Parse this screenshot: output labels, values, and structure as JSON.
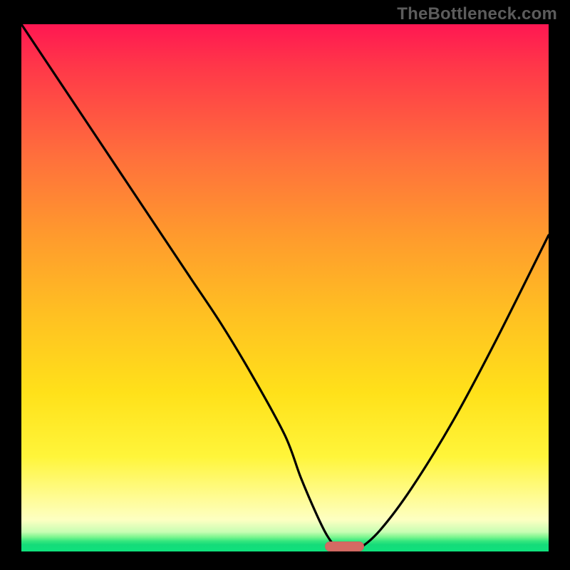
{
  "watermark": "TheBottleneck.com",
  "chart_data": {
    "type": "line",
    "title": "",
    "xlabel": "",
    "ylabel": "",
    "xlim": [
      0,
      100
    ],
    "ylim": [
      0,
      100
    ],
    "grid": false,
    "legend": false,
    "series": [
      {
        "name": "curve",
        "x": [
          0,
          8,
          14,
          20,
          26,
          32,
          38,
          44,
          50,
          53,
          56,
          58,
          60,
          62,
          64,
          68,
          74,
          82,
          90,
          100
        ],
        "y": [
          100,
          88,
          79,
          70,
          61,
          52,
          43,
          33,
          22,
          14,
          7,
          3,
          0.5,
          0,
          0.5,
          4,
          12,
          25,
          40,
          60
        ]
      }
    ],
    "marker": {
      "x_start": 57.5,
      "x_end": 65,
      "y": 1,
      "color": "#d46a63"
    },
    "background_gradient": {
      "direction": "vertical",
      "stops": [
        {
          "pos": 0.0,
          "color": "#ff1752"
        },
        {
          "pos": 0.25,
          "color": "#ff6f3c"
        },
        {
          "pos": 0.55,
          "color": "#ffc022"
        },
        {
          "pos": 0.82,
          "color": "#fff53a"
        },
        {
          "pos": 0.94,
          "color": "#fdffc2"
        },
        {
          "pos": 0.975,
          "color": "#79f58e"
        },
        {
          "pos": 1.0,
          "color": "#0fe27d"
        }
      ]
    }
  }
}
